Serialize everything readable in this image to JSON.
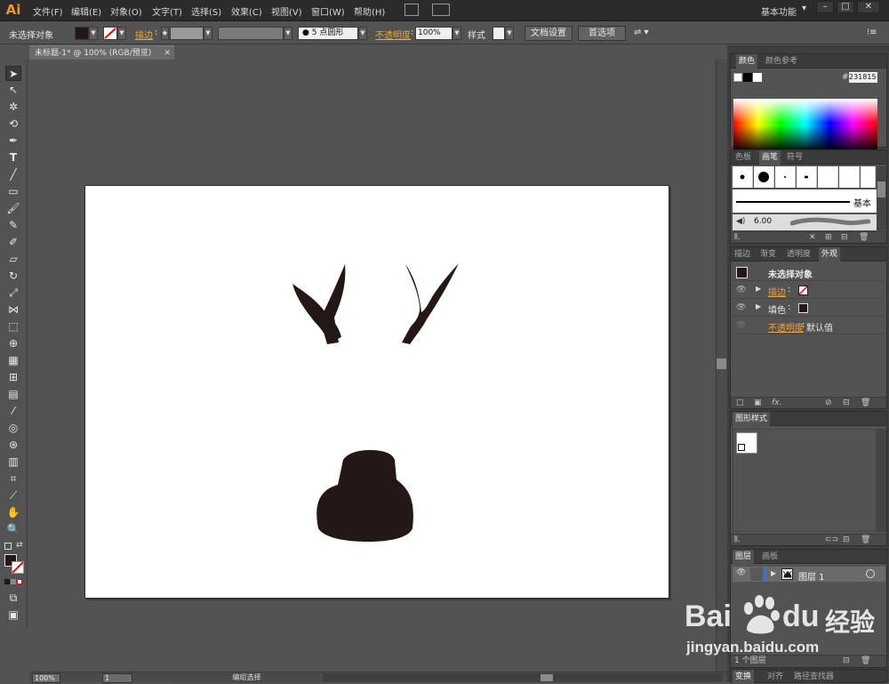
{
  "app": {
    "logo": "Ai",
    "menu": [
      "文件(F)",
      "编辑(E)",
      "对象(O)",
      "文字(T)",
      "选择(S)",
      "效果(C)",
      "视图(V)",
      "窗口(W)",
      "帮助(H)"
    ],
    "workspace": "基本功能",
    "window_controls": [
      "–",
      "□",
      "✕"
    ]
  },
  "control_bar": {
    "selection_status": "未选择对象",
    "stroke_label": "描边",
    "brush_size": "5",
    "brush_shape": "点圆形",
    "opacity_label": "不透明度",
    "opacity_value": "100%",
    "style_label": "样式",
    "doc_setup_button": "文档设置",
    "preferences_button": "首选项"
  },
  "document": {
    "tab_title": "未标题-1* @ 100% (RGB/预览)",
    "zoom": "100%",
    "artboard_number": "1",
    "status_text": "编组选择"
  },
  "color_panel": {
    "tabs": [
      "颜色",
      "颜色参考"
    ],
    "hex_value": "231815"
  },
  "brush_panel": {
    "tabs": [
      "色板",
      "画笔",
      "符号"
    ],
    "basic_label": "基本",
    "size_value": "6.00"
  },
  "appearance_panel": {
    "tabs": [
      "描边",
      "渐变",
      "透明度",
      "外观"
    ],
    "title": "未选择对象",
    "stroke_label": "描边",
    "fill_label": "填色",
    "opacity_label": "不透明度",
    "opacity_value": "默认值"
  },
  "graphic_styles_panel": {
    "tabs": [
      "图形样式"
    ]
  },
  "layers_panel": {
    "tabs": [
      "图层",
      "画板"
    ],
    "layer_name": "图层 1",
    "count_label": "1 个图层"
  },
  "bottom_panel": {
    "tabs": [
      "变换",
      "对齐",
      "路径查找器"
    ]
  },
  "colors": {
    "artwork_fill": "#231815",
    "accent_orange": "#f0a43a",
    "layer_highlight": "#3d6fd1"
  },
  "watermark": {
    "brand": "Bai",
    "brand_suffix": "du",
    "chinese": "经验",
    "url": "jingyan.baidu.com"
  }
}
